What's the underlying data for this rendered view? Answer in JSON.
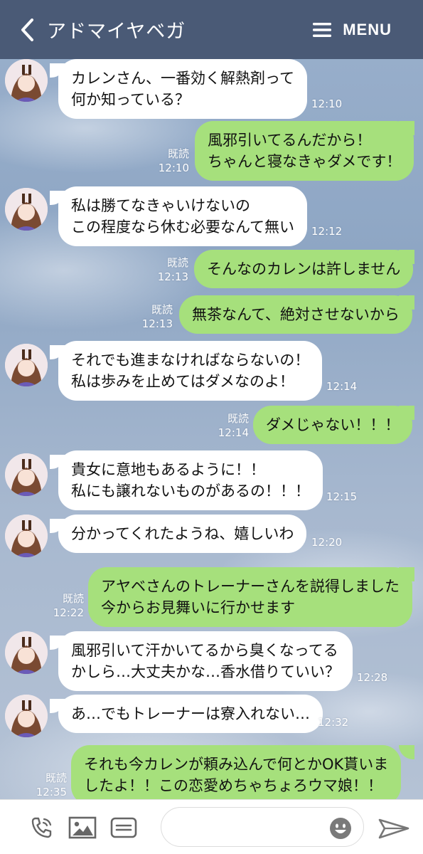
{
  "header": {
    "title": "アドマイヤベガ",
    "menu_label": "MENU",
    "back_icon": "chevron-left-icon",
    "menu_icon": "hamburger-icon"
  },
  "messages": [
    {
      "side": "in",
      "text": "カレンさん、一番効く解熱剤って\n何か知っている？",
      "time": "12:10"
    },
    {
      "side": "out",
      "text": "風邪引いてるんだから！\nちゃんと寝なきゃダメです！",
      "read": "既読",
      "time": "12:10"
    },
    {
      "side": "in",
      "text": "私は勝てなきゃいけないの\nこの程度なら休む必要なんて無い",
      "time": "12:12"
    },
    {
      "side": "out",
      "text": "そんなのカレンは許しません",
      "read": "既読",
      "time": "12:13"
    },
    {
      "side": "out",
      "text": "無茶なんて、絶対させないから",
      "read": "既読",
      "time": "12:13"
    },
    {
      "side": "in",
      "text": "それでも進まなければならないの！\n私は歩みを止めてはダメなのよ！",
      "time": "12:14"
    },
    {
      "side": "out",
      "text": "ダメじゃない！！！",
      "read": "既読",
      "time": "12:14"
    },
    {
      "side": "in",
      "text": "貴女に意地もあるように！！\n私にも譲れないものがあるの！！！",
      "time": "12:15"
    },
    {
      "side": "in",
      "text": "分かってくれたようね、嬉しいわ",
      "time": "12:20"
    },
    {
      "side": "out",
      "text": "アヤベさんのトレーナーさんを説得しました\n今からお見舞いに行かせます",
      "read": "既読",
      "time": "12:22"
    },
    {
      "side": "in",
      "text": "風邪引いて汗かいてるから臭くなってる\nかしら…大丈夫かな…香水借りていい？",
      "time": "12:28"
    },
    {
      "side": "in",
      "text": "あ…でもトレーナーは寮入れない…",
      "time": "12:32"
    },
    {
      "side": "out",
      "text": "それも今カレンが頼み込んで何とかOK貰いま\nしたよ！！この恋愛めちゃちょろウマ娘！！",
      "read": "既読",
      "time": "12:35"
    }
  ],
  "footer": {
    "call_icon": "phone-call-icon",
    "image_icon": "image-icon",
    "card_icon": "card-icon",
    "emoji_icon": "emoji-icon",
    "send_icon": "send-icon",
    "input_value": ""
  },
  "colors": {
    "header_bg": "#4a5a76",
    "outgoing_bubble": "#a6e07c",
    "incoming_bubble": "#ffffff"
  }
}
